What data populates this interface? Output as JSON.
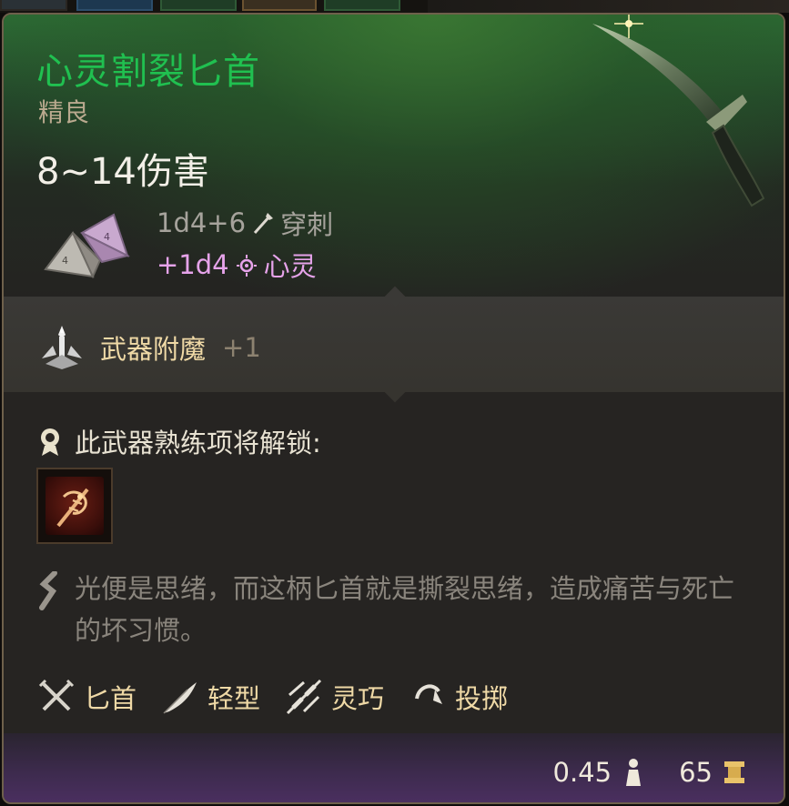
{
  "item": {
    "name": "心灵割裂匕首",
    "rarity": "精良",
    "damage_range": "8~14伤害",
    "damage_lines": [
      {
        "dice": "1d4+6",
        "type": "穿刺",
        "icon": "piercing-icon"
      },
      {
        "dice": "+1d4",
        "type": "心灵",
        "icon": "psychic-icon"
      }
    ],
    "enchantment": {
      "label": "武器附魔",
      "value": "+1"
    },
    "proficiency_label": "此武器熟练项将解锁:",
    "flavor_text": "光便是思绪，而这柄匕首就是撕裂思绪，造成痛苦与死亡的坏习惯。",
    "tags": [
      {
        "label": "匕首",
        "icon": "dagger-type-icon"
      },
      {
        "label": "轻型",
        "icon": "feather-icon"
      },
      {
        "label": "灵巧",
        "icon": "finesse-icon"
      },
      {
        "label": "投掷",
        "icon": "thrown-icon"
      }
    ],
    "weight": "0.45",
    "price": "65"
  },
  "colors": {
    "title": "#20c050",
    "rarity": "#b9a98e",
    "psychic": "#e6a3ea",
    "gold_text": "#efd9a6"
  }
}
